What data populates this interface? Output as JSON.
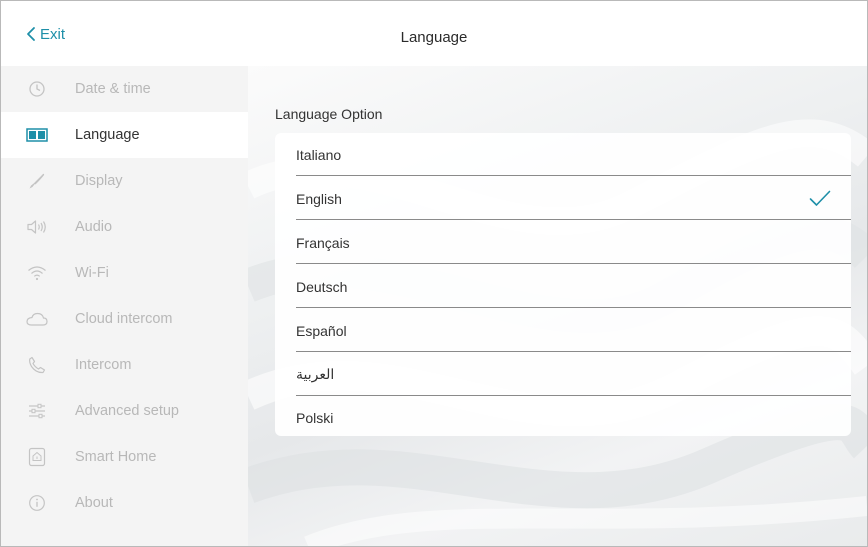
{
  "header": {
    "exit_label": "Exit",
    "title": "Language"
  },
  "sidebar": {
    "items": [
      {
        "label": "Date & time",
        "icon": "clock-icon",
        "active": false
      },
      {
        "label": "Language",
        "icon": "language-icon",
        "active": true
      },
      {
        "label": "Display",
        "icon": "brush-icon",
        "active": false
      },
      {
        "label": "Audio",
        "icon": "speaker-icon",
        "active": false
      },
      {
        "label": "Wi-Fi",
        "icon": "wifi-icon",
        "active": false
      },
      {
        "label": "Cloud intercom",
        "icon": "cloud-icon",
        "active": false
      },
      {
        "label": "Intercom",
        "icon": "phone-icon",
        "active": false
      },
      {
        "label": "Advanced setup",
        "icon": "sliders-icon",
        "active": false
      },
      {
        "label": "Smart Home",
        "icon": "smart-home-icon",
        "active": false
      },
      {
        "label": "About",
        "icon": "info-icon",
        "active": false
      }
    ]
  },
  "main": {
    "section_title": "Language Option",
    "languages": [
      {
        "label": "Italiano",
        "selected": false
      },
      {
        "label": "English",
        "selected": true
      },
      {
        "label": "Français",
        "selected": false
      },
      {
        "label": "Deutsch",
        "selected": false
      },
      {
        "label": "Español",
        "selected": false
      },
      {
        "label": "العربية",
        "selected": false
      },
      {
        "label": "Polski",
        "selected": false
      }
    ]
  },
  "colors": {
    "accent": "#1e8fa8",
    "active_text": "#333333",
    "inactive_text": "#b8b8b8"
  }
}
